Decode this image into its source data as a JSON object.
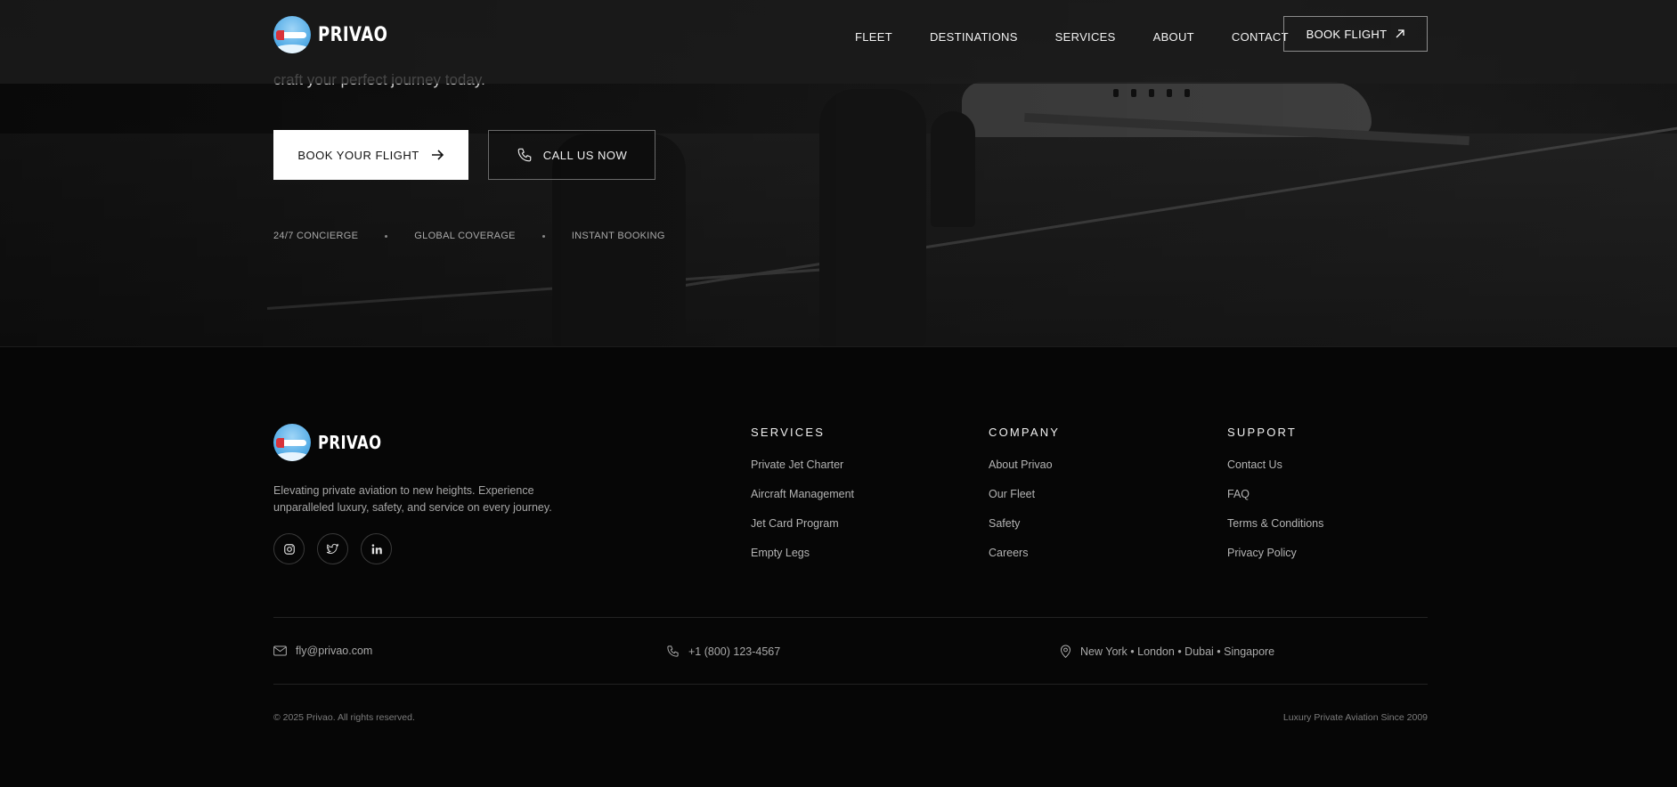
{
  "brand": {
    "name": "PRIVAO"
  },
  "nav": {
    "links": [
      "FLEET",
      "DESTINATIONS",
      "SERVICES",
      "ABOUT",
      "CONTACT"
    ],
    "book_label": "BOOK FLIGHT"
  },
  "hero": {
    "subtitle_fragment": "craft your perfect journey today.",
    "primary_button": "BOOK YOUR FLIGHT",
    "secondary_button": "CALL US NOW",
    "features": [
      "24/7 CONCIERGE",
      "GLOBAL COVERAGE",
      "INSTANT BOOKING"
    ]
  },
  "footer": {
    "tagline": "Elevating private aviation to new heights. Experience unparalleled luxury, safety, and service on every journey.",
    "socials": [
      "instagram-icon",
      "twitter-icon",
      "linkedin-icon"
    ],
    "columns": [
      {
        "title": "SERVICES",
        "items": [
          "Private Jet Charter",
          "Aircraft Management",
          "Jet Card Program",
          "Empty Legs"
        ]
      },
      {
        "title": "COMPANY",
        "items": [
          "About Privao",
          "Our Fleet",
          "Safety",
          "Careers"
        ]
      },
      {
        "title": "SUPPORT",
        "items": [
          "Contact Us",
          "FAQ",
          "Terms & Conditions",
          "Privacy Policy"
        ]
      }
    ],
    "contact": {
      "email": "fly@privao.com",
      "phone": "+1 (800) 123-4567",
      "locations": "New York • London • Dubai • Singapore"
    },
    "copyright": "© 2025 Privao. All rights reserved.",
    "since": "Luxury Private Aviation Since 2009"
  }
}
